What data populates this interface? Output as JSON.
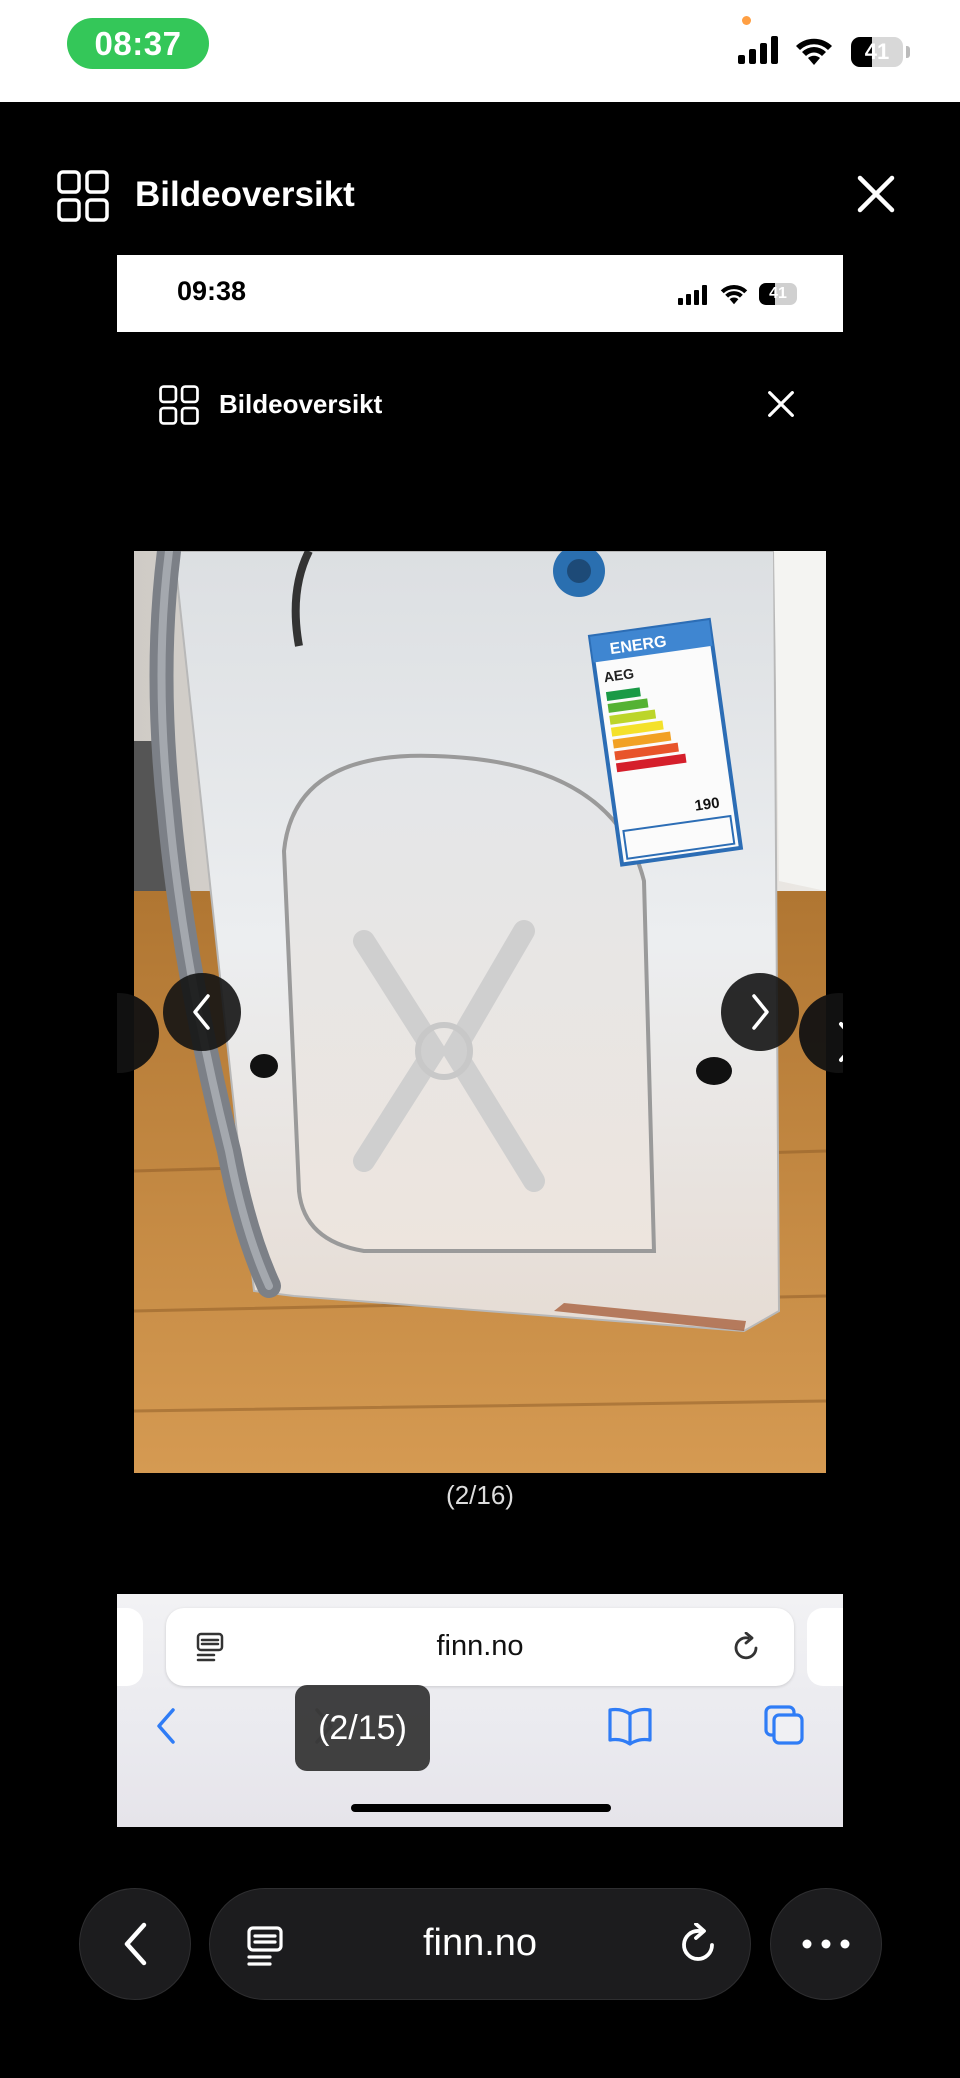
{
  "status_bar": {
    "time": "08:37",
    "battery": "41",
    "battery_level_percent": 41
  },
  "outer_header": {
    "title": "Bildeoversikt"
  },
  "inner_screenshot": {
    "status_time": "09:38",
    "battery": "41",
    "battery_level_percent": 41,
    "header_title": "Bildeoversikt",
    "photo_counter": "(2/16)",
    "url": "finn.no",
    "overlay_counter": "(2/15)"
  },
  "photo": {
    "energy_label_text": "ENERG",
    "brand": "AEG",
    "label_number": "190"
  },
  "bottom_bar": {
    "url": "finn.no"
  },
  "colors": {
    "time_pill": "#34c759",
    "safari_blue": "#2f7cf6",
    "background": "#000000"
  }
}
